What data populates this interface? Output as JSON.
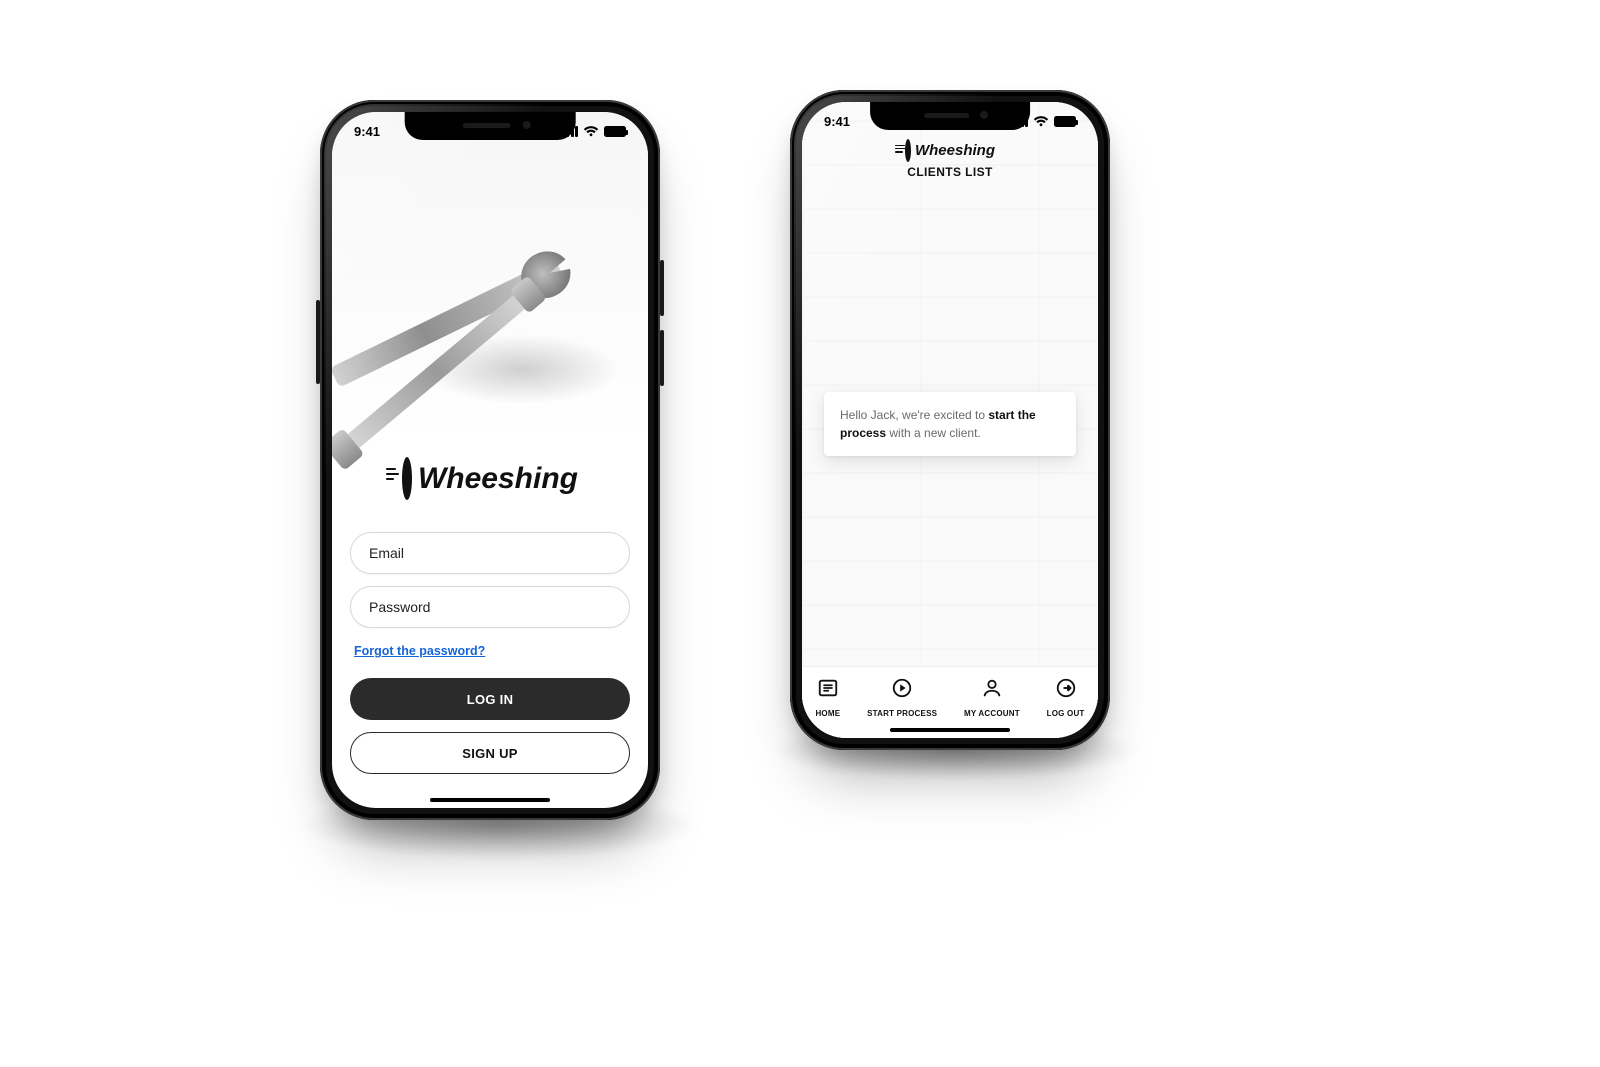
{
  "status": {
    "time": "9:41"
  },
  "brand": {
    "name": "Wheeshing"
  },
  "login": {
    "email_placeholder": "Email",
    "password_placeholder": "Password",
    "forgot_label": "Forgot the password?",
    "login_label": "LOG IN",
    "signup_label": "SIGN UP"
  },
  "clients": {
    "page_title": "CLIENTS LIST",
    "welcome_prefix": "Hello Jack, we're excited to ",
    "welcome_bold": "start the process",
    "welcome_suffix": " with a new client."
  },
  "tabs": {
    "home": "HOME",
    "start": "START PROCESS",
    "account": "MY ACCOUNT",
    "logout": "LOG OUT"
  }
}
